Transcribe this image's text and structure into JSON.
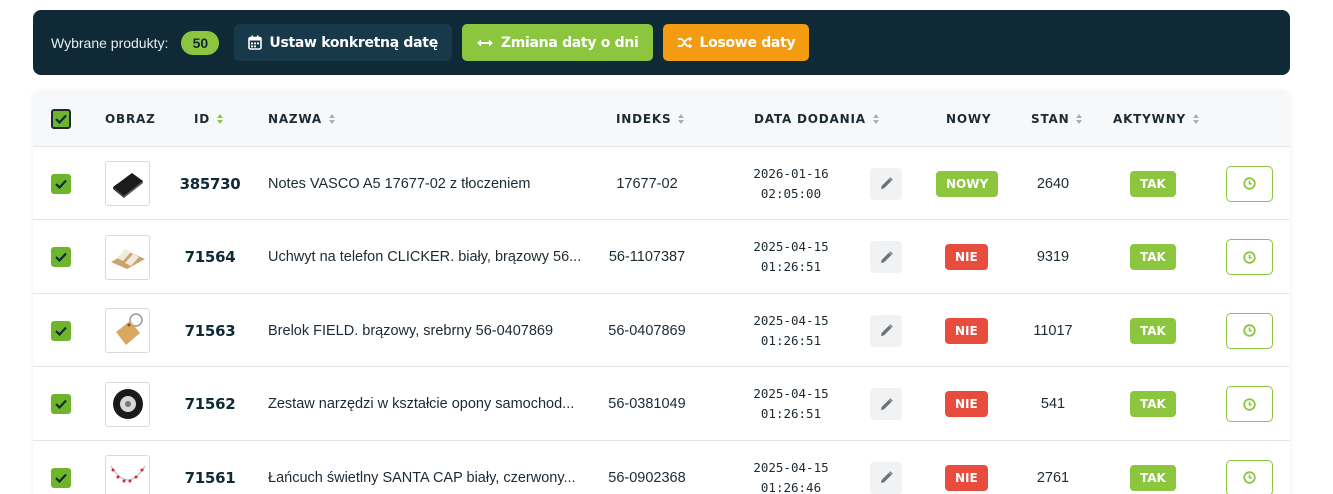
{
  "toolbar": {
    "selected_label": "Wybrane produkty:",
    "selected_count": "50",
    "set_date_label": "Ustaw konkretną datę",
    "shift_days_label": "Zmiana daty o dni",
    "random_dates_label": "Losowe daty"
  },
  "columns": {
    "image": "OBRAZ",
    "id": "ID",
    "name": "NAZWA",
    "index": "INDEKS",
    "date_added": "DATA DODANIA",
    "new": "NOWY",
    "stock": "STAN",
    "active": "AKTYWNY"
  },
  "rows": [
    {
      "id": "385730",
      "name": "Notes VASCO A5 17677-02 z tłoczeniem",
      "index": "17677-02",
      "date": "2026-01-16",
      "time": "02:05:00",
      "new_label": "NOWY",
      "stock": "2640",
      "active_label": "TAK"
    },
    {
      "id": "71564",
      "name": "Uchwyt na telefon CLICKER. biały, brązowy 56...",
      "index": "56-1107387",
      "date": "2025-04-15",
      "time": "01:26:51",
      "new_label": "NIE",
      "stock": "9319",
      "active_label": "TAK"
    },
    {
      "id": "71563",
      "name": "Brelok FIELD. brązowy, srebrny 56-0407869",
      "index": "56-0407869",
      "date": "2025-04-15",
      "time": "01:26:51",
      "new_label": "NIE",
      "stock": "11017",
      "active_label": "TAK"
    },
    {
      "id": "71562",
      "name": "Zestaw narzędzi w kształcie opony samochod...",
      "index": "56-0381049",
      "date": "2025-04-15",
      "time": "01:26:51",
      "new_label": "NIE",
      "stock": "541",
      "active_label": "TAK"
    },
    {
      "id": "71561",
      "name": "Łańcuch świetlny SANTA CAP biały, czerwony...",
      "index": "56-0902368",
      "date": "2025-04-15",
      "time": "01:26:46",
      "new_label": "NIE",
      "stock": "2761",
      "active_label": "TAK"
    }
  ],
  "colors": {
    "toolbar_bg": "#0f2a36",
    "accent_green": "#8cc63f",
    "accent_orange": "#f39c12",
    "danger_red": "#e74c3c"
  },
  "icons": {
    "set_date": "calendar-icon",
    "shift_days": "arrows-horizontal-icon",
    "random_dates": "shuffle-icon",
    "edit": "pencil-icon",
    "history": "clock-icon",
    "checkbox": "checkmark-icon"
  }
}
